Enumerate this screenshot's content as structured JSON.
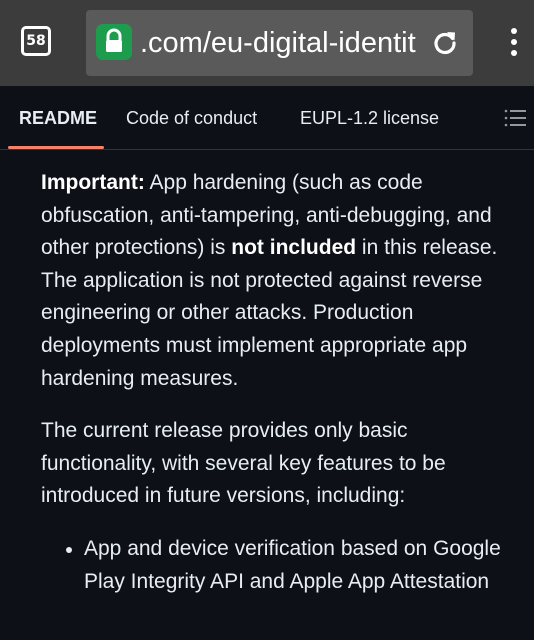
{
  "browser": {
    "tab_count": "58",
    "url": ".com/eu-digital-identity",
    "icons": {
      "lock": "lock-icon",
      "reload": "reload-icon",
      "menu": "overflow-menu-icon"
    },
    "lock_color": "#1e9c4e"
  },
  "repo_tabs": [
    {
      "label": "README",
      "active": true
    },
    {
      "label": "Code of conduct",
      "active": false
    },
    {
      "label": "EUPL-1.2 license",
      "active": false
    }
  ],
  "tab_accent": "#f78166",
  "readme": {
    "important_label": "Important:",
    "important_text_1": " App hardening (such as code obfuscation, anti-tampering, anti-debugging, and other protections) is ",
    "important_bold": "not included",
    "important_text_2": " in this release. The application is not protected against reverse engineering or other attacks. Production deployments must implement appropriate app hardening measures.",
    "release_text": "The current release provides only basic functionality, with several key features to be introduced in future versions, including:",
    "features": [
      "App and device verification based on Google Play Integrity API and Apple App Attestation"
    ]
  }
}
